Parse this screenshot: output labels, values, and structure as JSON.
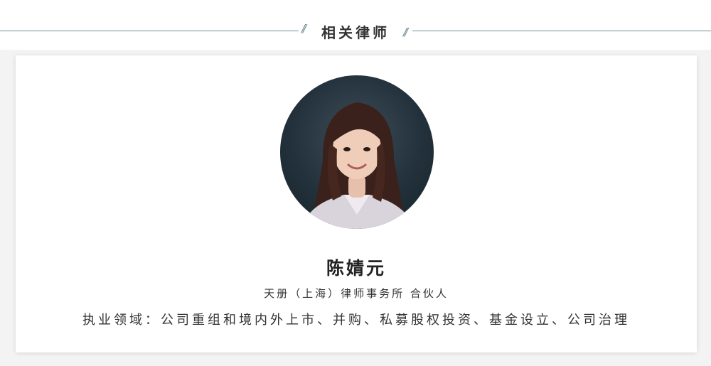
{
  "section": {
    "title": "相关律师"
  },
  "lawyer": {
    "name": "陈婧元",
    "firm": "天册（上海）律师事务所 合伙人",
    "practice": "执业领域：公司重组和境内外上市、并购、私募股权投资、基金设立、公司治理"
  },
  "colors": {
    "accent_line": "#6f8f96",
    "avatar_bg": "#22313b"
  }
}
